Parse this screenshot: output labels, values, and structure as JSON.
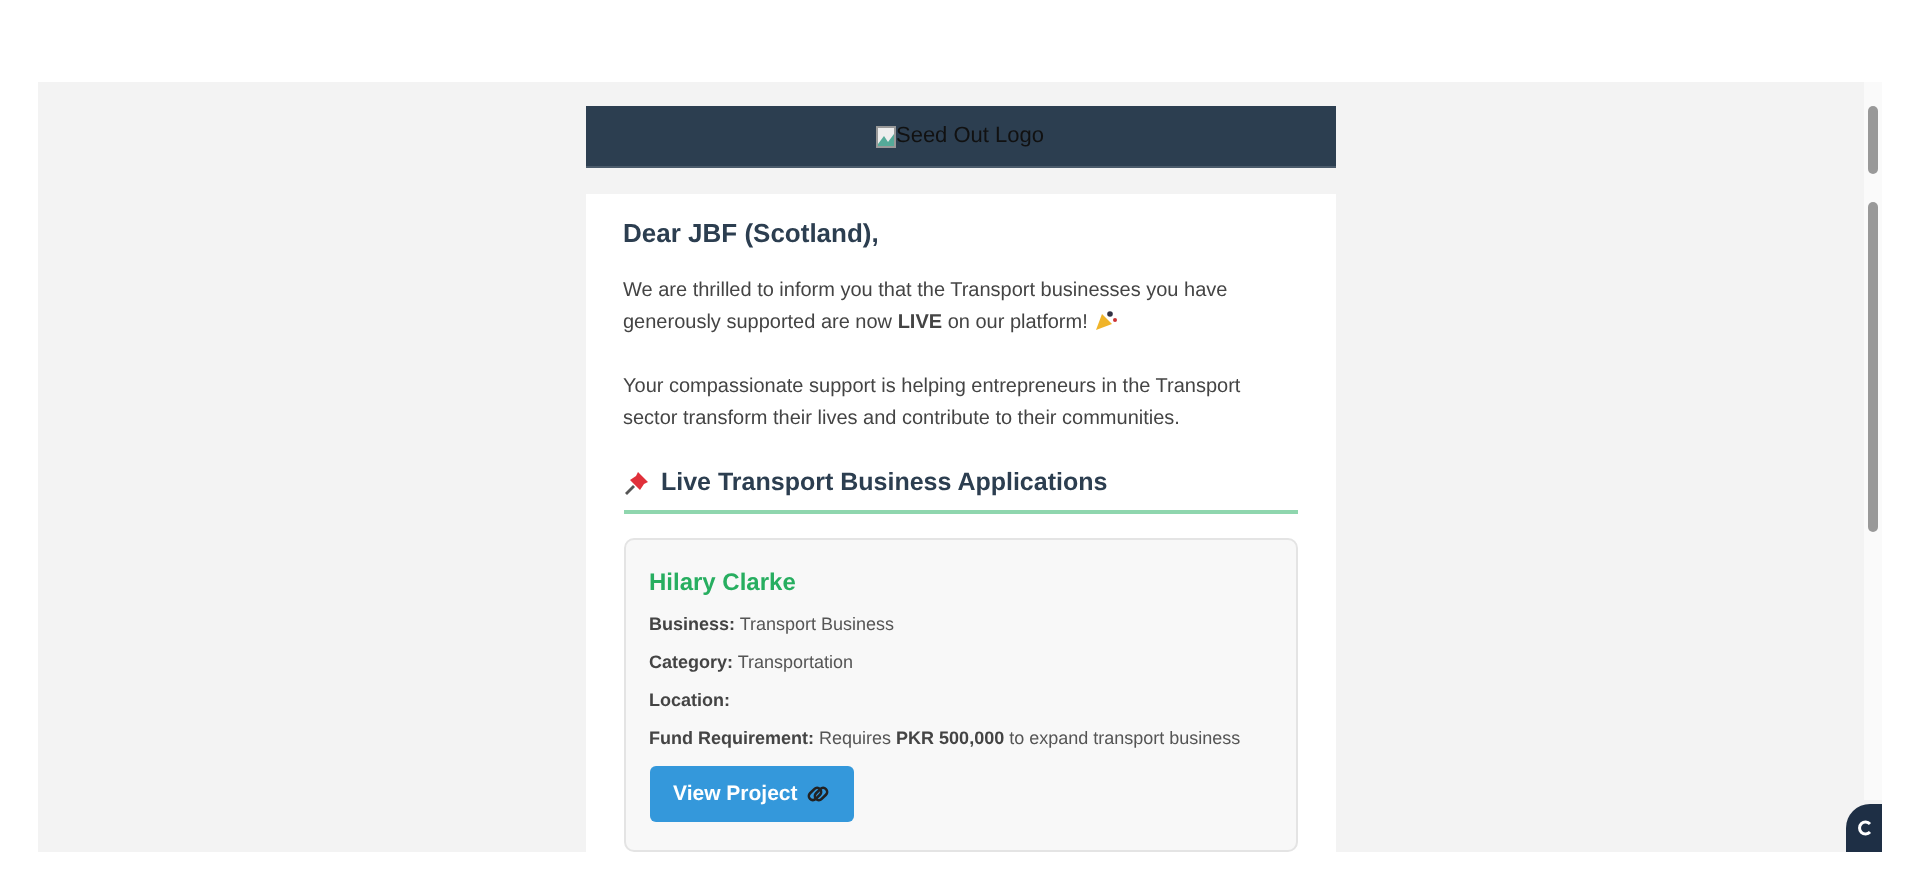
{
  "header": {
    "logo_alt": "Seed Out Logo"
  },
  "greeting": "Dear JBF (Scotland),",
  "paragraphs": [
    "We are thrilled to inform you that the Transport businesses you have generously supported are now **LIVE** on our platform!",
    "Your compassionate support is helping entrepreneurs in the Transport sector transform their lives and contribute to their communities."
  ],
  "section_title": "Live Transport Business Applications",
  "applications": [
    {
      "name": "Hilary Clarke",
      "fields": [
        {
          "label": "Business:",
          "value": "Transport Business"
        },
        {
          "label": "Category:",
          "value": "Transportation"
        },
        {
          "label": "Location:"
        },
        {
          "label": "Fund Requirement:",
          "value": "Requires **PKR 500,000** to expand transport business"
        }
      ],
      "button": "View Project"
    }
  ]
}
